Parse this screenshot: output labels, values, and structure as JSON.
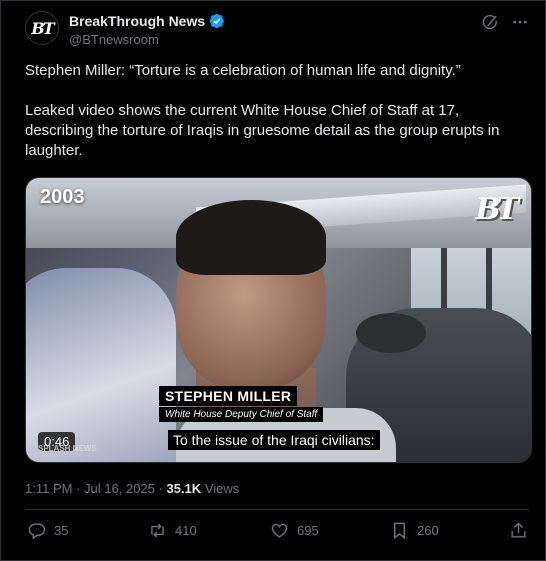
{
  "author": {
    "display_name": "BreakThrough News",
    "handle": "@BTnewsroom",
    "avatar_text": "BT",
    "verified": true
  },
  "tweet": {
    "paragraphs": [
      "Stephen Miller: “Torture is a celebration of human life and dignity.”",
      "Leaked video shows the current White House Chief of Staff at 17, describing the torture of Iraqis in gruesome detail as the group erupts in laughter."
    ]
  },
  "media": {
    "year_label": "2003",
    "logo_text": "BT",
    "lower_third_name": "STEPHEN MILLER",
    "lower_third_title": "White House Deputy Chief of Staff",
    "subtitle": "To the issue of the Iraqi civilians:",
    "duration": "0:46",
    "watermark": "SPLASH NEWS"
  },
  "meta": {
    "time": "1:11 PM",
    "date": "Jul 16, 2025",
    "separator": "·",
    "views_count": "35.1K",
    "views_label": "Views"
  },
  "actions": {
    "replies": "35",
    "reposts": "410",
    "likes": "695",
    "bookmarks": "260"
  },
  "colors": {
    "background": "#000000",
    "text": "#e7e9ea",
    "muted": "#71767b",
    "verified": "#1d9bf0",
    "border": "#2f3336"
  }
}
